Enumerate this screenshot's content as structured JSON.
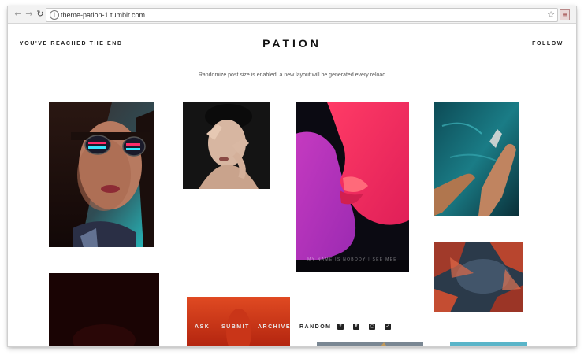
{
  "browser": {
    "url": "theme-pation-1.tumblr.com",
    "back_icon": "back-arrow-icon",
    "forward_icon": "forward-arrow-icon",
    "reload_icon": "reload-icon"
  },
  "header": {
    "left_text": "YOU'VE REACHED THE END",
    "title": "PATION",
    "right_text": "FOLLOW"
  },
  "notice": "Randomize post size is enabled, a new layout will be generated every reload",
  "posts": {
    "kiss_watermark": "MY NAME IS NOBODY | SEE MEE"
  },
  "bottom_nav": {
    "ask": "ASK",
    "submit": "SUBMIT",
    "archive": "ARCHIVE",
    "random": "RANDOM",
    "social": [
      "tumblr-icon",
      "facebook-icon",
      "instagram-icon",
      "twitter-icon"
    ]
  },
  "colors": {
    "brand_text": "#111111",
    "accent_pink": "#e0337a",
    "background": "#ffffff"
  }
}
